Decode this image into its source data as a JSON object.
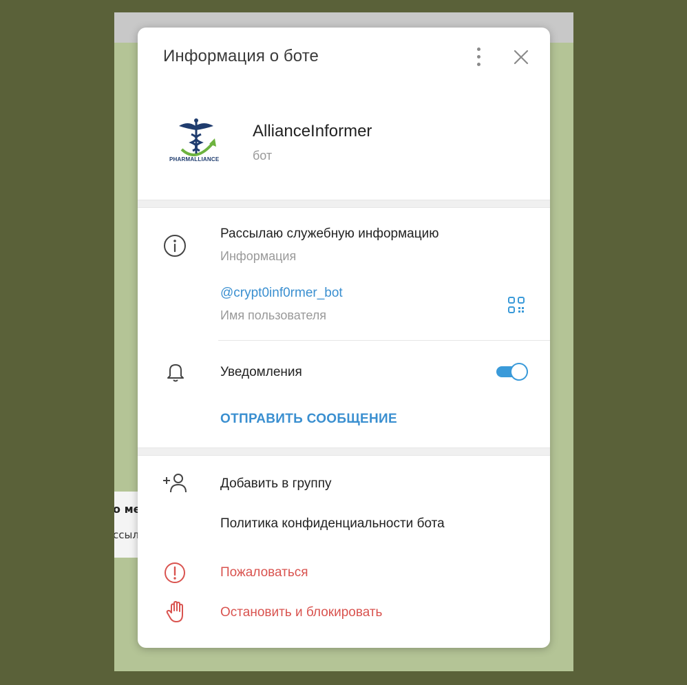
{
  "background": {
    "message_title_fragment": "о ме",
    "message_text_fragment": "ссыл"
  },
  "dialog": {
    "title": "Информация о боте",
    "more_icon": "more-vertical-icon",
    "close_icon": "close-icon"
  },
  "profile": {
    "name": "AllianceInformer",
    "subtitle": "бот",
    "logo_text": "PHARMALLIANCE"
  },
  "info": {
    "description": "Рассылаю служебную информацию",
    "description_label": "Информация",
    "username": "@crypt0inf0rmer_bot",
    "username_label": "Имя пользователя"
  },
  "notifications": {
    "label": "Уведомления",
    "enabled": true
  },
  "actions": {
    "send_message": "ОТПРАВИТЬ СООБЩЕНИЕ",
    "add_to_group": "Добавить в группу",
    "privacy_policy": "Политика конфиденциальности бота",
    "report": "Пожаловаться",
    "stop_block": "Остановить и блокировать"
  },
  "colors": {
    "accent": "#3a8fd0",
    "danger": "#d9534f",
    "page_background": "#5a6139"
  }
}
